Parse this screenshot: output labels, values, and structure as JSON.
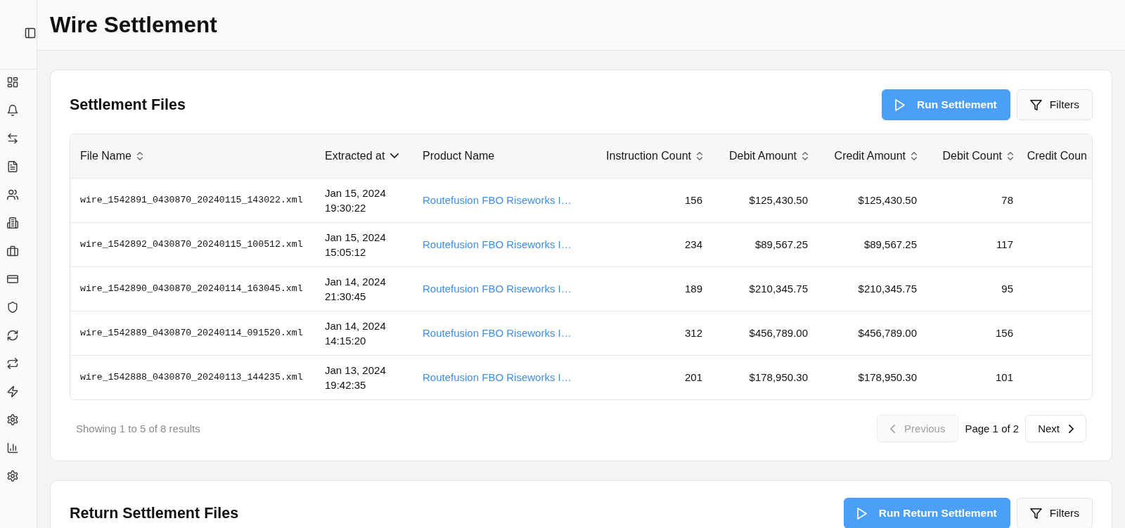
{
  "header": {
    "title": "Wire Settlement"
  },
  "sections": [
    {
      "title": "Settlement Files",
      "actions": [
        {
          "kind": "primary",
          "label": "Run Settlement"
        },
        {
          "kind": "secondary",
          "label": "Filters"
        }
      ],
      "table": {
        "columns": [
          {
            "label": "File Name",
            "kind": "file",
            "sort": {
              "kind": "unsorted"
            }
          },
          {
            "label": "Extracted at",
            "kind": "datetime",
            "sort": {
              "kind": "descending"
            }
          },
          {
            "label": "Product Name",
            "kind": "link"
          },
          {
            "label": "Instruction Count",
            "kind": "count",
            "sort": {
              "kind": "unsorted"
            }
          },
          {
            "label": "Debit Amount",
            "kind": "amount",
            "sort": {
              "kind": "unsorted"
            }
          },
          {
            "label": "Credit Amount",
            "kind": "amount",
            "sort": {
              "kind": "unsorted"
            }
          },
          {
            "label": "Debit Count",
            "kind": "count",
            "sort": {
              "kind": "unsorted"
            }
          },
          {
            "label": "Credit Coun",
            "kind": "count"
          }
        ],
        "rows": [
          [
            "wire_1542891_0430870_20240115_143022.xml",
            "Jan 15, 2024 19:30:22",
            "Routefusion FBO Riseworks I…",
            "156",
            "$125,430.50",
            "$125,430.50",
            "78"
          ],
          [
            "wire_1542892_0430870_20240115_100512.xml",
            "Jan 15, 2024 15:05:12",
            "Routefusion FBO Riseworks I…",
            "234",
            "$89,567.25",
            "$89,567.25",
            "117"
          ],
          [
            "wire_1542890_0430870_20240114_163045.xml",
            "Jan 14, 2024 21:30:45",
            "Routefusion FBO Riseworks I…",
            "189",
            "$210,345.75",
            "$210,345.75",
            "95"
          ],
          [
            "wire_1542889_0430870_20240114_091520.xml",
            "Jan 14, 2024 14:15:20",
            "Routefusion FBO Riseworks I…",
            "312",
            "$456,789.00",
            "$456,789.00",
            "156"
          ],
          [
            "wire_1542888_0430870_20240113_144235.xml",
            "Jan 13, 2024 19:42:35",
            "Routefusion FBO Riseworks I…",
            "201",
            "$178,950.30",
            "$178,950.30",
            "101"
          ]
        ]
      },
      "footer": {
        "summary": "Showing 1 to 5 of 8 results",
        "pagination": {
          "previous": {
            "label": "Previous",
            "disabled": true
          },
          "page": "Page 1 of 2",
          "next": {
            "label": "Next",
            "disabled": false
          }
        }
      }
    },
    {
      "title": "Return Settlement Files",
      "actions": [
        {
          "kind": "primary",
          "label": "Run Return Settlement"
        },
        {
          "kind": "secondary",
          "label": "Filters"
        }
      ]
    }
  ]
}
